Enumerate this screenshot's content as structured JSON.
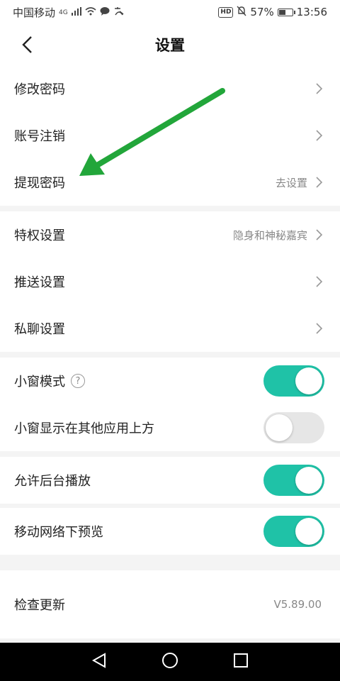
{
  "status_bar": {
    "carrier": "中国移动",
    "network": "4G",
    "battery_percent": "57%",
    "battery_level": 0.57,
    "time": "13:56",
    "hd_label": "HD"
  },
  "header": {
    "title": "设置"
  },
  "sections": {
    "account": {
      "change_password": {
        "label": "修改密码"
      },
      "cancel_account": {
        "label": "账号注销"
      },
      "withdraw_password": {
        "label": "提现密码",
        "value": "去设置"
      }
    },
    "privacy": {
      "privilege": {
        "label": "特权设置",
        "value": "隐身和神秘嘉宾"
      },
      "push": {
        "label": "推送设置"
      },
      "private_chat": {
        "label": "私聊设置"
      }
    },
    "window": {
      "mini_mode": {
        "label": "小窗模式",
        "help": "?",
        "enabled": true
      },
      "overlay": {
        "label": "小窗显示在其他应用上方",
        "enabled": false
      }
    },
    "background_play": {
      "label": "允许后台播放",
      "enabled": true
    },
    "mobile_preview": {
      "label": "移动网络下预览",
      "enabled": true
    },
    "update": {
      "label": "检查更新",
      "value": "V5.89.00"
    }
  },
  "annotation": {
    "arrow_color": "#22a63a"
  },
  "colors": {
    "toggle_on": "#1fc2a7",
    "toggle_off": "#e6e6e6"
  },
  "nav_bar": {
    "buttons": [
      "back-triangle-icon",
      "home-circle-icon",
      "recents-square-icon"
    ]
  }
}
